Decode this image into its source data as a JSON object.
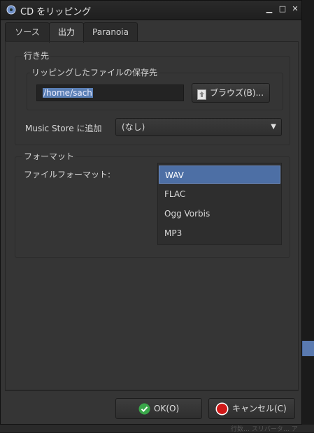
{
  "window": {
    "title": "CD をリッピング",
    "minimize_glyph": "▁",
    "maximize_glyph": "□",
    "close_glyph": "✕"
  },
  "tabs": [
    {
      "label": "ソース"
    },
    {
      "label": "出力"
    },
    {
      "label": "Paranoia"
    }
  ],
  "destination": {
    "heading": "行き先",
    "save_location_label": "リッピングしたファイルの保存先",
    "path_value": "/home/sach",
    "browse_label": "ブラウズ(B)...",
    "music_store_label": "Music Store に追加",
    "music_store_value": "(なし)"
  },
  "format": {
    "heading": "フォーマット",
    "file_format_label": "ファイルフォーマット:",
    "options": [
      "WAV",
      "FLAC",
      "Ogg Vorbis",
      "MP3"
    ],
    "selected": "WAV"
  },
  "buttons": {
    "ok": "OK(O)",
    "cancel": "キャンセル(C)"
  },
  "background": {
    "status_text": "行数… スリバータ… ア"
  },
  "colors": {
    "selection": "#4d6fa5",
    "ok_icon": "#3aa64a",
    "cancel_icon": "#d01818"
  }
}
